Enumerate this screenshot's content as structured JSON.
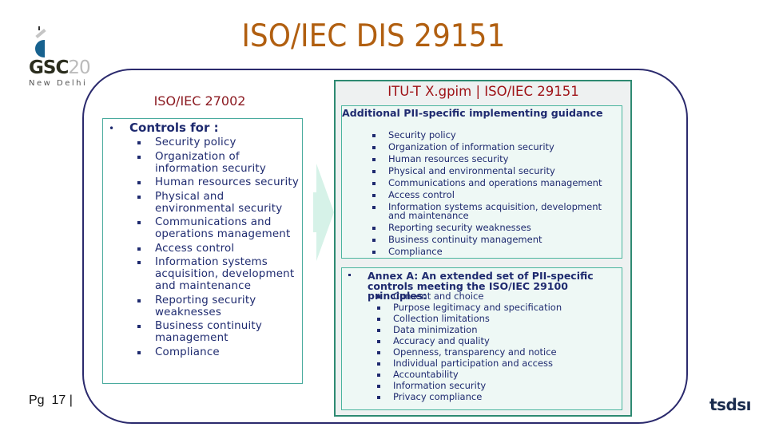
{
  "slide": {
    "title": "ISO/IEC DIS 29151",
    "page_label": "Pg  17 |",
    "logos": {
      "top_left": {
        "mark": "G20",
        "brand_prefix": "GSC",
        "brand_suffix": "20",
        "city": "New Delhi"
      },
      "bottom_right": {
        "text": "tsdsı"
      }
    }
  },
  "left_panel": {
    "title": "ISO/IEC 27002",
    "heading": "Controls for  :",
    "items": [
      "Security policy",
      "Organization of information security",
      "Human resources security",
      "Physical and environmental security",
      "Communications and operations management",
      "Access control",
      "Information systems acquisition, development and maintenance",
      "Reporting security weaknesses",
      "Business continuity management",
      "Compliance"
    ]
  },
  "right_panel": {
    "title": "ITU-T X.gpim | ISO/IEC 29151",
    "subtitle": "Additional PII-specific implementing guidance",
    "items": [
      "Security policy",
      "Organization of information security",
      "Human resources security",
      "Physical and environmental security",
      "Communications and operations management",
      "Access control",
      "Information systems acquisition, development and maintenance",
      "Reporting security weaknesses",
      "Business continuity management",
      "Compliance"
    ],
    "annex_heading": "Annex A: An extended set of PII-specific controls meeting the ISO/IEC 29100 principles:",
    "annex_items": [
      "Consent and choice",
      "Purpose legitimacy and specification",
      "Collection limitations",
      "Data minimization",
      "Accuracy and quality",
      "Openness, transparency and notice",
      "Individual participation and access",
      "Accountability",
      "Information security",
      "Privacy compliance"
    ]
  },
  "colors": {
    "title": "#b15f10",
    "panel_title": "#9e1115",
    "body_text": "#1e2a6f",
    "frame": "#2b2a6d",
    "teal_border": "#2e8a72",
    "mint_fill": "#eef8f5",
    "arrow": "#d3f0e6"
  }
}
